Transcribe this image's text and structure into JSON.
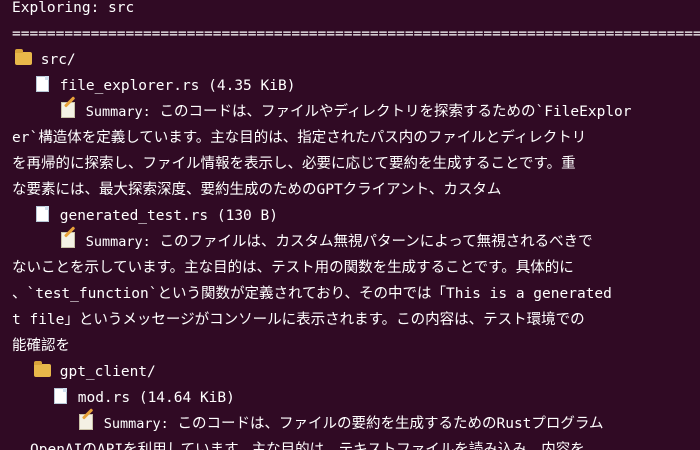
{
  "terminal": {
    "header": "Exploring: src",
    "separator": "========================================================================================================================",
    "root_folder": "src/",
    "file1": "file_explorer.rs (4.35 KiB)",
    "file1_summary_label": "Summary:",
    "file1_summary_l1": "このコードは、ファイルやディレクトリを探索するための`FileExplor",
    "file1_summary_l2": "er`構造体を定義しています。主な目的は、指定されたパス内のファイルとディレクトリ",
    "file1_summary_l3": "を再帰的に探索し、ファイル情報を表示し、必要に応じて要約を生成することです。重",
    "file1_summary_l4": "な要素には、最大探索深度、要約生成のためのGPTクライアント、カスタム",
    "file2": "generated_test.rs (130 B)",
    "file2_summary_label": "Summary:",
    "file2_summary_l1": "このファイルは、カスタム無視パターンによって無視されるべきで",
    "file2_summary_l2": "ないことを示しています。主な目的は、テスト用の関数を生成することです。具体的に",
    "file2_summary_l3": "、`test_function`という関数が定義されており、その中では「This is a generated",
    "file2_summary_l4": "t file」というメッセージがコンソールに表示されます。この内容は、テスト環境での",
    "file2_summary_l5": "能確認を",
    "subfolder": "gpt_client/",
    "file3": "mod.rs (14.64 KiB)",
    "file3_summary_label": "Summary:",
    "file3_summary_l1": "このコードは、ファイルの要約を生成するためのRustプログラム",
    "file3_summary_l2": "OpenAIのAPIを利用しています。主な目的は、テキストファイルを読み込み、内容を"
  }
}
